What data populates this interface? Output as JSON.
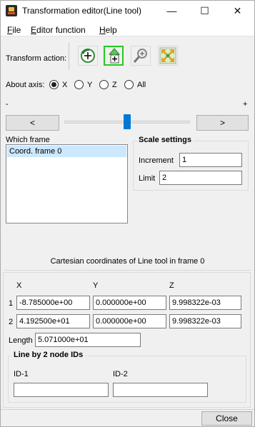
{
  "window": {
    "title": "Transformation editor(Line tool)",
    "minimize_glyph": "—",
    "maximize_glyph": "☐",
    "close_glyph": "✕"
  },
  "menu": {
    "file": {
      "mnemonic": "F",
      "rest": "ile"
    },
    "editor": {
      "mnemonic": "E",
      "rest": "ditor function"
    },
    "help": {
      "mnemonic": "H",
      "rest": "elp"
    }
  },
  "transform_action": {
    "label": "Transform action:",
    "tools": [
      {
        "name": "rotate",
        "icon": "rotate-icon",
        "active": false
      },
      {
        "name": "translate",
        "icon": "translate-icon",
        "active": true
      },
      {
        "name": "scale",
        "icon": "zoom-icon",
        "active": false
      },
      {
        "name": "fit",
        "icon": "expand-icon",
        "active": false
      }
    ]
  },
  "about_axis": {
    "label": "About axis:",
    "options": [
      "X",
      "Y",
      "Z",
      "All"
    ],
    "selected": "X"
  },
  "slider": {
    "minus_label": "-",
    "plus_label": "+",
    "left_button": "<",
    "right_button": ">",
    "position": 0.5
  },
  "which_frame": {
    "label": "Which frame",
    "items": [
      "Coord. frame 0"
    ],
    "selected": "Coord. frame 0"
  },
  "scale_settings": {
    "title": "Scale settings",
    "increment_label": "Increment",
    "increment_value": "1",
    "limit_label": "Limit",
    "limit_value": "2"
  },
  "coords": {
    "caption": "Cartesian coordinates of Line tool in frame 0",
    "headers": [
      "X",
      "Y",
      "Z"
    ],
    "rows": [
      {
        "index": "1",
        "x": "-8.785000e+00",
        "y": "0.000000e+00",
        "z": "9.998322e-03"
      },
      {
        "index": "2",
        "x": "4.192500e+01",
        "y": "0.000000e+00",
        "z": "9.998322e-03"
      }
    ],
    "length_label": "Length",
    "length_value": "5.071000e+01"
  },
  "node_ids": {
    "title": "Line by 2 node IDs",
    "id1_label": "ID-1",
    "id1_value": "",
    "id2_label": "ID-2",
    "id2_value": ""
  },
  "footer": {
    "close_label": "Close"
  },
  "colors": {
    "active_tool_border": "#22cc22",
    "slider_thumb": "#0078d7",
    "list_selection": "#cce8ff"
  }
}
